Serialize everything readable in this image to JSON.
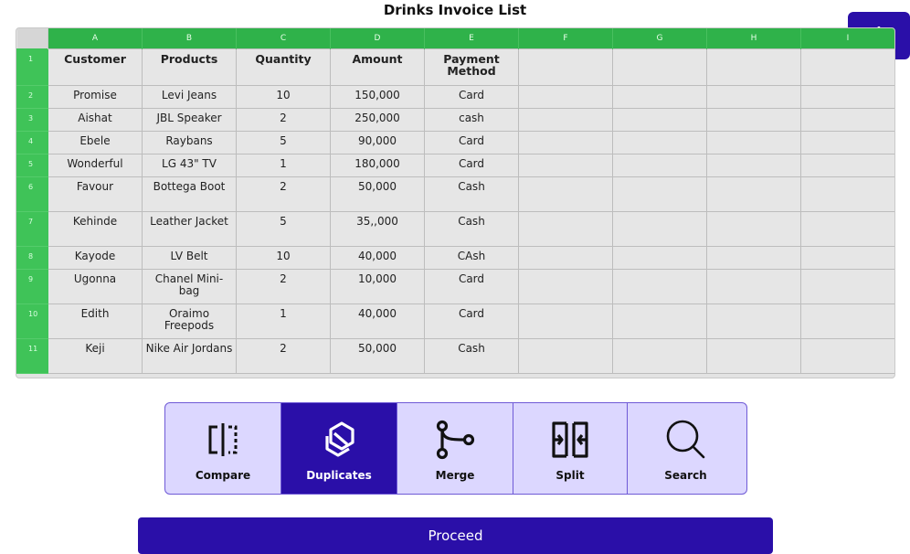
{
  "page": {
    "title": "Drinks Invoice List"
  },
  "add_button": {
    "label": "+"
  },
  "sheet": {
    "columns": [
      "A",
      "B",
      "C",
      "D",
      "E",
      "F",
      "G",
      "H",
      "I"
    ],
    "header": {
      "row_num": "1",
      "cells": [
        "Customer",
        "Products",
        "Quantity",
        "Amount",
        "Payment Method"
      ]
    },
    "rows": [
      {
        "row_num": "2",
        "cells": [
          "Promise",
          "Levi Jeans",
          "10",
          "150,000",
          "Card"
        ]
      },
      {
        "row_num": "3",
        "cells": [
          "Aishat",
          "JBL Speaker",
          "2",
          "250,000",
          "cash"
        ]
      },
      {
        "row_num": "4",
        "cells": [
          "Ebele",
          "Raybans",
          "5",
          "90,000",
          "Card"
        ]
      },
      {
        "row_num": "5",
        "cells": [
          "Wonderful",
          "LG 43\" TV",
          "1",
          "180,000",
          "Card"
        ]
      },
      {
        "row_num": "6",
        "cells": [
          "Favour",
          "Bottega Boot",
          "2",
          "50,000",
          "Cash"
        ]
      },
      {
        "row_num": "7",
        "cells": [
          "Kehinde",
          "Leather Jacket",
          "5",
          "35,,000",
          "Cash"
        ]
      },
      {
        "row_num": "8",
        "cells": [
          "Kayode",
          "LV Belt",
          "10",
          "40,000",
          "CAsh"
        ]
      },
      {
        "row_num": "9",
        "cells": [
          "Ugonna",
          "Chanel Mini-bag",
          "2",
          "10,000",
          "Card"
        ]
      },
      {
        "row_num": "10",
        "cells": [
          "Edith",
          "Oraimo Freepods",
          "1",
          "40,000",
          "Card"
        ]
      },
      {
        "row_num": "11",
        "cells": [
          "Keji",
          "Nike Air Jordans",
          "2",
          "50,000",
          "Cash"
        ]
      }
    ]
  },
  "toolbar": {
    "compare_label": "Compare",
    "duplicates_label": "Duplicates",
    "merge_label": "Merge",
    "split_label": "Split",
    "search_label": "Search"
  },
  "proceed": {
    "label": "Proceed"
  },
  "colors": {
    "accent": "#2a0fa8",
    "sheet_green": "#2fb24a",
    "toolbar_bg": "#dcd7ff"
  }
}
